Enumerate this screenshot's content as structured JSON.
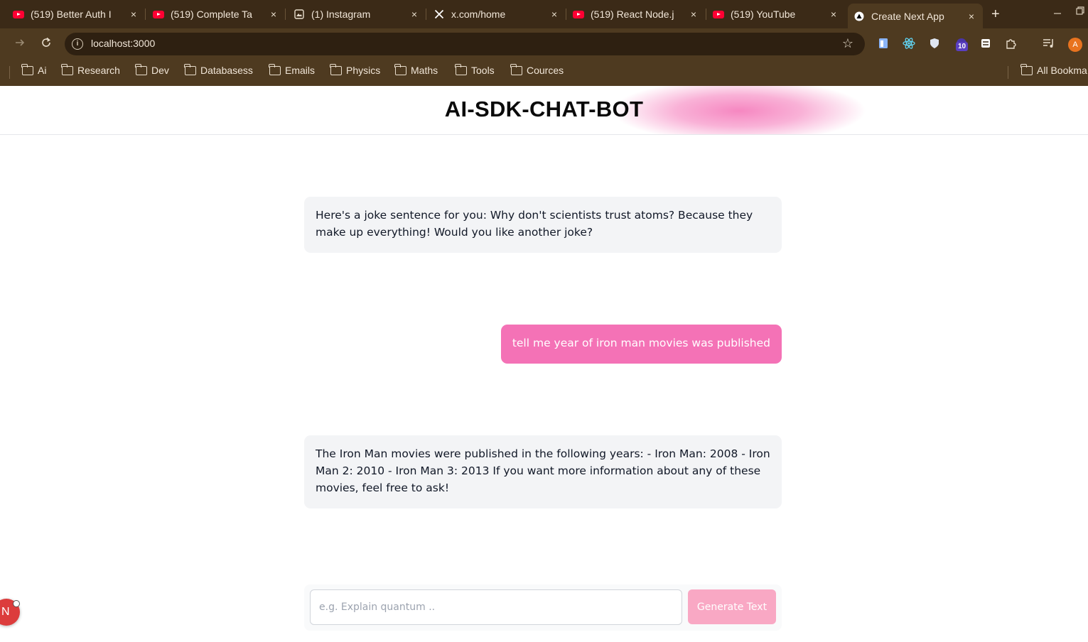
{
  "browser": {
    "tabs": [
      {
        "title": "(519) Better Auth I",
        "icon": "youtube-icon"
      },
      {
        "title": "(519) Complete Ta",
        "icon": "youtube-icon"
      },
      {
        "title": "(1) Instagram",
        "icon": "instagram-icon"
      },
      {
        "title": "x.com/home",
        "icon": "x-icon"
      },
      {
        "title": "(519) React Node.j",
        "icon": "youtube-icon"
      },
      {
        "title": "(519) YouTube",
        "icon": "youtube-icon"
      },
      {
        "title": "Create Next App",
        "icon": "nextjs-icon"
      }
    ],
    "close_glyph": "×",
    "new_tab_glyph": "+",
    "url": "localhost:3000",
    "extension_badge": "10",
    "profile_initial": "A",
    "bookmarks": [
      "Ai",
      "Research",
      "Dev",
      "Databasess",
      "Emails",
      "Physics",
      "Maths",
      "Tools",
      "Cources"
    ],
    "all_bookmarks": "All Bookma"
  },
  "app": {
    "title": "AI-SDK-CHAT-BOT",
    "accent": "#f472b6",
    "messages": [
      {
        "role": "assistant",
        "text": "Here's a joke sentence for you: Why don't scientists trust atoms? Because they make up everything! Would you like another joke?"
      },
      {
        "role": "user",
        "text": "tell me year of iron man movies was published"
      },
      {
        "role": "assistant",
        "text": "The Iron Man movies were published in the following years: - Iron Man: 2008 - Iron Man 2: 2010 - Iron Man 3: 2013 If you want more information about any of these movies, feel free to ask!"
      }
    ],
    "input": {
      "value": "",
      "placeholder": "e.g. Explain quantum .."
    },
    "generate_label": "Generate Text",
    "dev_badge": "N"
  }
}
